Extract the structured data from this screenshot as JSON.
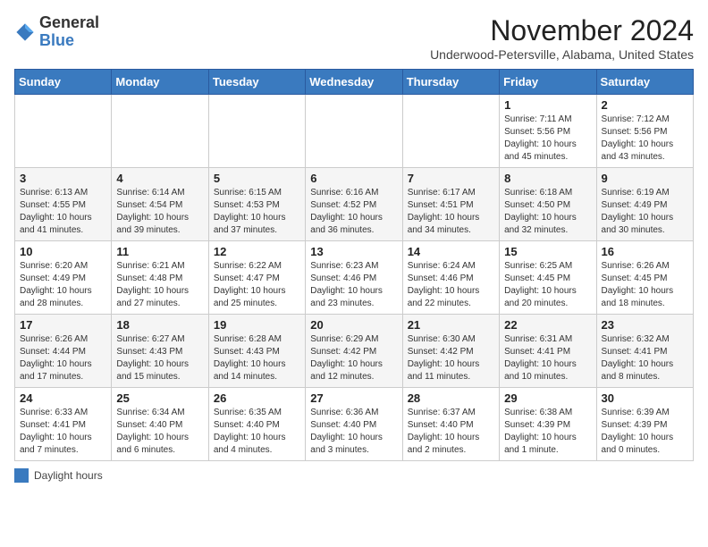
{
  "header": {
    "logo_general": "General",
    "logo_blue": "Blue",
    "month_title": "November 2024",
    "location": "Underwood-Petersville, Alabama, United States"
  },
  "calendar": {
    "days_of_week": [
      "Sunday",
      "Monday",
      "Tuesday",
      "Wednesday",
      "Thursday",
      "Friday",
      "Saturday"
    ],
    "weeks": [
      [
        {
          "day": "",
          "info": ""
        },
        {
          "day": "",
          "info": ""
        },
        {
          "day": "",
          "info": ""
        },
        {
          "day": "",
          "info": ""
        },
        {
          "day": "",
          "info": ""
        },
        {
          "day": "1",
          "info": "Sunrise: 7:11 AM\nSunset: 5:56 PM\nDaylight: 10 hours\nand 45 minutes."
        },
        {
          "day": "2",
          "info": "Sunrise: 7:12 AM\nSunset: 5:56 PM\nDaylight: 10 hours\nand 43 minutes."
        }
      ],
      [
        {
          "day": "3",
          "info": "Sunrise: 6:13 AM\nSunset: 4:55 PM\nDaylight: 10 hours\nand 41 minutes."
        },
        {
          "day": "4",
          "info": "Sunrise: 6:14 AM\nSunset: 4:54 PM\nDaylight: 10 hours\nand 39 minutes."
        },
        {
          "day": "5",
          "info": "Sunrise: 6:15 AM\nSunset: 4:53 PM\nDaylight: 10 hours\nand 37 minutes."
        },
        {
          "day": "6",
          "info": "Sunrise: 6:16 AM\nSunset: 4:52 PM\nDaylight: 10 hours\nand 36 minutes."
        },
        {
          "day": "7",
          "info": "Sunrise: 6:17 AM\nSunset: 4:51 PM\nDaylight: 10 hours\nand 34 minutes."
        },
        {
          "day": "8",
          "info": "Sunrise: 6:18 AM\nSunset: 4:50 PM\nDaylight: 10 hours\nand 32 minutes."
        },
        {
          "day": "9",
          "info": "Sunrise: 6:19 AM\nSunset: 4:49 PM\nDaylight: 10 hours\nand 30 minutes."
        }
      ],
      [
        {
          "day": "10",
          "info": "Sunrise: 6:20 AM\nSunset: 4:49 PM\nDaylight: 10 hours\nand 28 minutes."
        },
        {
          "day": "11",
          "info": "Sunrise: 6:21 AM\nSunset: 4:48 PM\nDaylight: 10 hours\nand 27 minutes."
        },
        {
          "day": "12",
          "info": "Sunrise: 6:22 AM\nSunset: 4:47 PM\nDaylight: 10 hours\nand 25 minutes."
        },
        {
          "day": "13",
          "info": "Sunrise: 6:23 AM\nSunset: 4:46 PM\nDaylight: 10 hours\nand 23 minutes."
        },
        {
          "day": "14",
          "info": "Sunrise: 6:24 AM\nSunset: 4:46 PM\nDaylight: 10 hours\nand 22 minutes."
        },
        {
          "day": "15",
          "info": "Sunrise: 6:25 AM\nSunset: 4:45 PM\nDaylight: 10 hours\nand 20 minutes."
        },
        {
          "day": "16",
          "info": "Sunrise: 6:26 AM\nSunset: 4:45 PM\nDaylight: 10 hours\nand 18 minutes."
        }
      ],
      [
        {
          "day": "17",
          "info": "Sunrise: 6:26 AM\nSunset: 4:44 PM\nDaylight: 10 hours\nand 17 minutes."
        },
        {
          "day": "18",
          "info": "Sunrise: 6:27 AM\nSunset: 4:43 PM\nDaylight: 10 hours\nand 15 minutes."
        },
        {
          "day": "19",
          "info": "Sunrise: 6:28 AM\nSunset: 4:43 PM\nDaylight: 10 hours\nand 14 minutes."
        },
        {
          "day": "20",
          "info": "Sunrise: 6:29 AM\nSunset: 4:42 PM\nDaylight: 10 hours\nand 12 minutes."
        },
        {
          "day": "21",
          "info": "Sunrise: 6:30 AM\nSunset: 4:42 PM\nDaylight: 10 hours\nand 11 minutes."
        },
        {
          "day": "22",
          "info": "Sunrise: 6:31 AM\nSunset: 4:41 PM\nDaylight: 10 hours\nand 10 minutes."
        },
        {
          "day": "23",
          "info": "Sunrise: 6:32 AM\nSunset: 4:41 PM\nDaylight: 10 hours\nand 8 minutes."
        }
      ],
      [
        {
          "day": "24",
          "info": "Sunrise: 6:33 AM\nSunset: 4:41 PM\nDaylight: 10 hours\nand 7 minutes."
        },
        {
          "day": "25",
          "info": "Sunrise: 6:34 AM\nSunset: 4:40 PM\nDaylight: 10 hours\nand 6 minutes."
        },
        {
          "day": "26",
          "info": "Sunrise: 6:35 AM\nSunset: 4:40 PM\nDaylight: 10 hours\nand 4 minutes."
        },
        {
          "day": "27",
          "info": "Sunrise: 6:36 AM\nSunset: 4:40 PM\nDaylight: 10 hours\nand 3 minutes."
        },
        {
          "day": "28",
          "info": "Sunrise: 6:37 AM\nSunset: 4:40 PM\nDaylight: 10 hours\nand 2 minutes."
        },
        {
          "day": "29",
          "info": "Sunrise: 6:38 AM\nSunset: 4:39 PM\nDaylight: 10 hours\nand 1 minute."
        },
        {
          "day": "30",
          "info": "Sunrise: 6:39 AM\nSunset: 4:39 PM\nDaylight: 10 hours\nand 0 minutes."
        }
      ]
    ]
  },
  "legend": {
    "label": "Daylight hours"
  }
}
